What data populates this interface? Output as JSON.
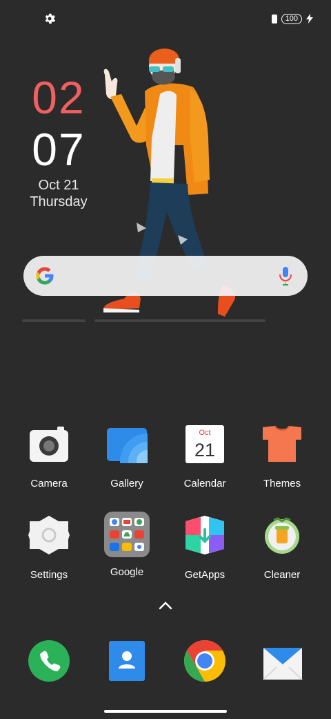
{
  "status": {
    "battery": "100"
  },
  "clock": {
    "hour": "02",
    "minute": "07",
    "date": "Oct 21",
    "day": "Thursday"
  },
  "search": {
    "provider": "Google"
  },
  "apps": [
    {
      "label": "Camera",
      "icon": "camera-icon"
    },
    {
      "label": "Gallery",
      "icon": "gallery-icon"
    },
    {
      "label": "Calendar",
      "icon": "calendar-icon",
      "month": "Oct",
      "day": "21"
    },
    {
      "label": "Themes",
      "icon": "themes-icon"
    },
    {
      "label": "Settings",
      "icon": "settings-icon"
    },
    {
      "label": "Google",
      "icon": "google-folder-icon"
    },
    {
      "label": "GetApps",
      "icon": "getapps-icon"
    },
    {
      "label": "Cleaner",
      "icon": "cleaner-icon"
    }
  ],
  "dock": [
    {
      "icon": "phone-icon"
    },
    {
      "icon": "contacts-icon"
    },
    {
      "icon": "chrome-icon"
    },
    {
      "icon": "messages-icon"
    }
  ],
  "colors": {
    "background": "#2b2b2b",
    "clock_hour": "#f06060",
    "accent_green": "#2bb157"
  }
}
